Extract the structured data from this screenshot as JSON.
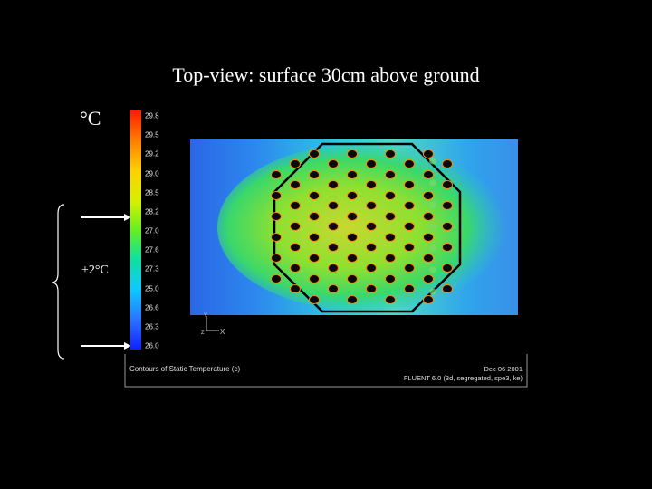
{
  "title": "Top-view: surface 30cm above ground",
  "colorbar": {
    "unit": "°C",
    "ticks": [
      "29.8",
      "29.5",
      "29.2",
      "29.0",
      "28.5",
      "28.2",
      "27.0",
      "27.6",
      "27.3",
      "25.0",
      "26.6",
      "26.3",
      "26.0"
    ]
  },
  "annotation": {
    "delta": "+2°C"
  },
  "axes_glyph": {
    "y": "Y",
    "x": "X",
    "z": "Z"
  },
  "caption": {
    "left": "Contours of Static Temperature (c)",
    "date": "Dec 06  2001",
    "solver": "FLUENT 6.0 (3d, segregated, spe3, ke)"
  },
  "colors": {
    "background": "#000000",
    "accent_hot": "#ff2000",
    "accent_cold": "#1a3cff"
  }
}
